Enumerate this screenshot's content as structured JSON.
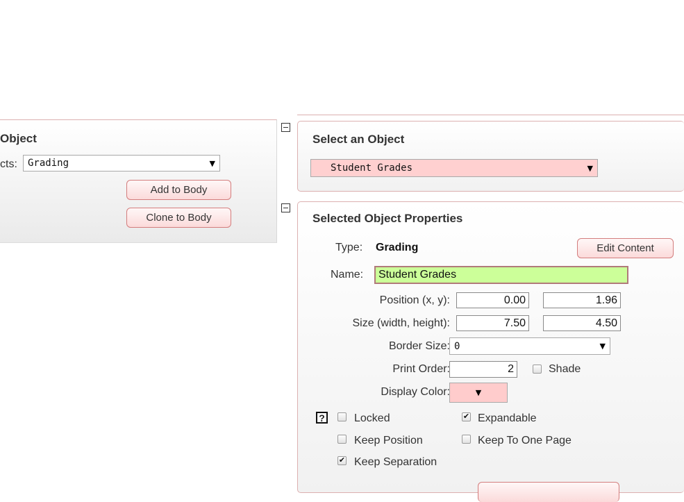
{
  "left": {
    "title_fragment": "Object",
    "label_fragment": "cts:",
    "select_value": "Grading",
    "add_button": "Add to Body",
    "clone_button": "Clone to Body"
  },
  "select_panel": {
    "title": "Select an Object",
    "select_value": "Student Grades",
    "select_bg": "#ffd0d0"
  },
  "properties": {
    "title": "Selected Object Properties",
    "type_label": "Type:",
    "type_value": "Grading",
    "edit_button": "Edit Content",
    "name_label": "Name:",
    "name_value": "Student Grades",
    "name_bg": "#ccff99",
    "position_label": "Position (x, y):",
    "position_x": "0.00",
    "position_y": "1.96",
    "size_label": "Size (width, height):",
    "size_w": "7.50",
    "size_h": "4.50",
    "border_label": "Border Size:",
    "border_value": "0",
    "print_order_label": "Print Order:",
    "print_order_value": "2",
    "shade_label": "Shade",
    "display_color_label": "Display Color:",
    "display_color": "#ffcccc",
    "help_glyph": "?",
    "checkboxes": [
      {
        "label": "Locked",
        "checked": false
      },
      {
        "label": "Expandable",
        "checked": true
      },
      {
        "label": "Keep Position",
        "checked": false
      },
      {
        "label": "Keep To One Page",
        "checked": false
      },
      {
        "label": "Keep Separation",
        "checked": true
      }
    ],
    "check_glyph": "✔",
    "arrow_glyph": "▼"
  }
}
